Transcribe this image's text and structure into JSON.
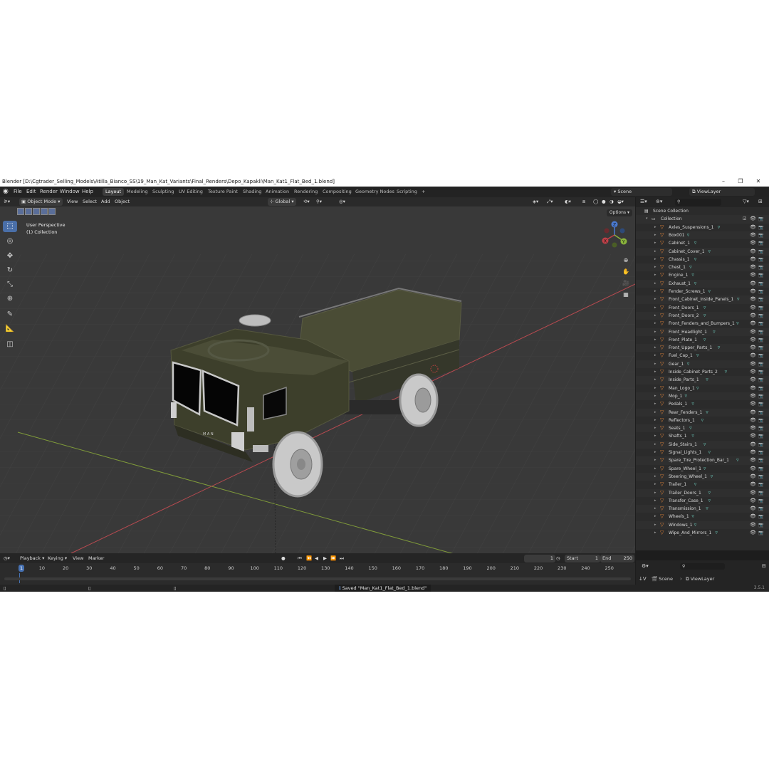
{
  "window": {
    "title": "Blender [D:\\Cgtrader_Selling_Models\\Atilla_Bianco_SS\\19_Man_Kat_Variants\\Final_Renders\\Depo_Kapakli\\Man_Kat1_Flat_Bed_1.blend]",
    "controls": [
      "–",
      "❐",
      "✕"
    ]
  },
  "menu": [
    "File",
    "Edit",
    "Render",
    "Window",
    "Help"
  ],
  "workspaces": [
    "Layout",
    "Modeling",
    "Sculpting",
    "UV Editing",
    "Texture Paint",
    "Shading",
    "Animation",
    "Rendering",
    "Compositing",
    "Geometry Nodes",
    "Scripting",
    "+"
  ],
  "active_workspace": "Layout",
  "scene_field": "Scene",
  "viewlayer_field": "ViewLayer",
  "viewport": {
    "mode": "Object Mode",
    "menus": [
      "View",
      "Select",
      "Add",
      "Object"
    ],
    "orientation": "Global",
    "options_label": "Options",
    "perspective_label": "User Perspective",
    "collection_label": "(1) Collection",
    "gizmo_axes": [
      "X",
      "Y",
      "Z"
    ]
  },
  "outliner": {
    "root": "Scene Collection",
    "collection": "Collection",
    "items": [
      "Axles_Suspensions_1",
      "Box001",
      "Cabinet_1",
      "Cabinet_Cover_1",
      "Chassis_1",
      "Chest_1",
      "Engine_1",
      "Exhaust_1",
      "Fender_Screws_1",
      "Front_Cabinet_Inside_Panels_1",
      "Front_Doors_1",
      "Front_Doors_2",
      "Front_Fenders_and_Bumpers_1",
      "Front_Headlight_1",
      "Front_Plate_1",
      "Front_Upper_Parts_1",
      "Fuel_Cap_1",
      "Gear_1",
      "Inside_Cabinet_Parts_2",
      "Inside_Parts_1",
      "Man_Logo_1",
      "Mop_1",
      "Pedals_1",
      "Rear_Fenders_1",
      "Reflectors_1",
      "Seats_1",
      "Shafts_1",
      "Side_Stairs_1",
      "Signal_Lights_1",
      "Spare_Tire_Protection_Bar_1",
      "Spare_Wheel_1",
      "Steering_Wheel_1",
      "Trailer_1",
      "Trailer_Doors_1",
      "Transfer_Case_1",
      "Transmission_1",
      "Wheels_1",
      "Windows_1",
      "Wipe_And_Mirrors_1"
    ]
  },
  "properties": {
    "scene": "Scene",
    "viewlayer": "ViewLayer",
    "version": "3.5.1"
  },
  "timeline": {
    "menus": [
      "Playback",
      "Keying",
      "View",
      "Marker"
    ],
    "current_frame": "1",
    "start_label": "Start",
    "start": "1",
    "end_label": "End",
    "end": "250",
    "ruler_current": "1",
    "ticks": [
      "10",
      "20",
      "30",
      "40",
      "50",
      "60",
      "70",
      "80",
      "90",
      "100",
      "110",
      "120",
      "130",
      "140",
      "150",
      "160",
      "170",
      "180",
      "190",
      "200",
      "210",
      "220",
      "230",
      "240",
      "250"
    ]
  },
  "status": {
    "message": "Saved \"Man_Kat1_Flat_Bed_1.blend\""
  },
  "colors": {
    "accent": "#4772b3",
    "truck_body": "#3b3d2a",
    "x_axis": "#b84a50",
    "y_axis": "#8aa23a"
  }
}
